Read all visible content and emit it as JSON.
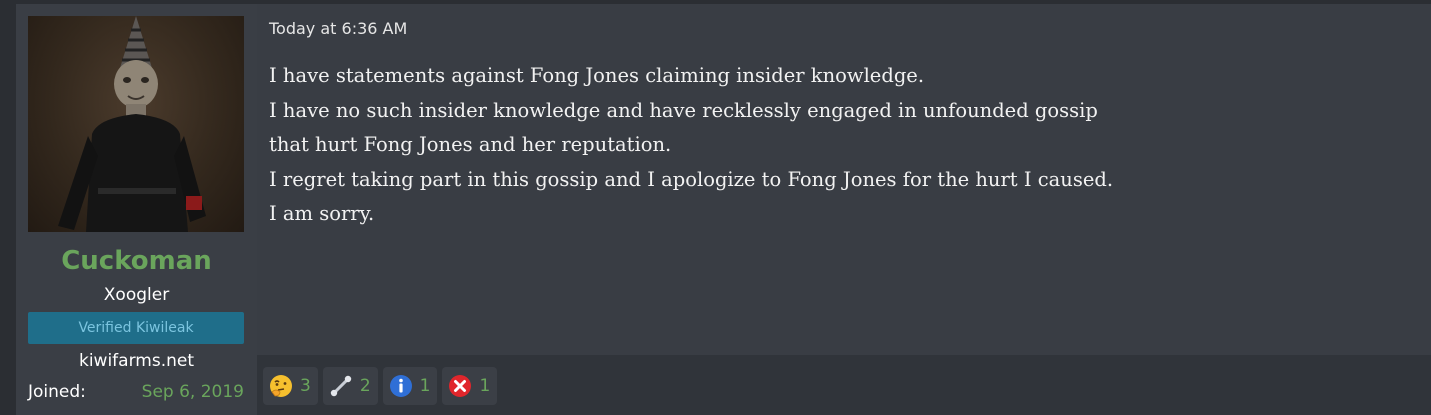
{
  "post": {
    "date": "Today at 6:36 AM",
    "lines": [
      "I have statements against Fong Jones claiming insider knowledge.",
      "I have no such insider knowledge and have recklessly engaged in unfounded gossip",
      "that hurt Fong Jones and her reputation.",
      "I regret taking part in this gossip and I apologize to Fong Jones for the hurt I caused.",
      "I am sorry."
    ]
  },
  "user": {
    "name": "Cuckoman",
    "title": "Xoogler",
    "banner": "Verified Kiwileak",
    "site": "kiwifarms.net",
    "joined_label": "Joined:",
    "joined_value": "Sep 6, 2019"
  },
  "reactions": [
    {
      "icon": "thinking-face-icon",
      "count": "3"
    },
    {
      "icon": "pin-connector-icon",
      "count": "2"
    },
    {
      "icon": "info-icon",
      "count": "1"
    },
    {
      "icon": "red-x-icon",
      "count": "1"
    }
  ],
  "colors": {
    "username": "#6aa55c",
    "banner_bg": "#1f6e8a",
    "banner_text": "#7bc4df",
    "count": "#6aa55c",
    "post_bg": "#393d44",
    "footer_bg": "#30343a"
  }
}
